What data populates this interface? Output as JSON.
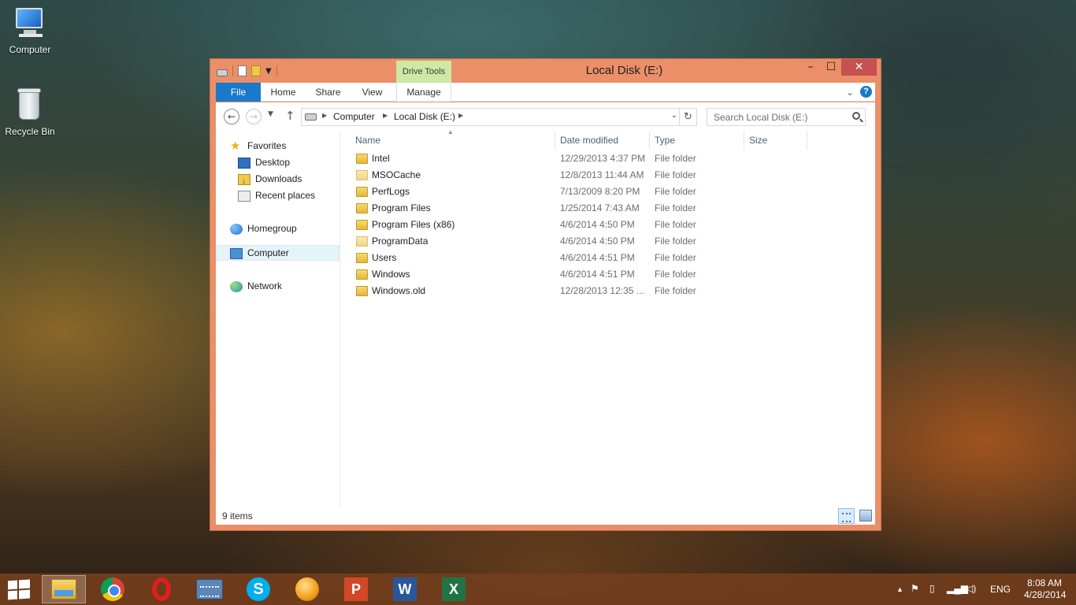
{
  "desktop": {
    "icons": [
      {
        "label": "Computer"
      },
      {
        "label": "Recycle Bin"
      }
    ]
  },
  "window": {
    "title": "Local Disk (E:)",
    "context_tab_group": "Drive Tools",
    "controls": {
      "minimize": "–",
      "maximize": "☐",
      "close": "✕"
    },
    "ribbon_tabs": {
      "file": "File",
      "home": "Home",
      "share": "Share",
      "view": "View",
      "manage": "Manage"
    },
    "help": "?"
  },
  "navigation": {
    "back": "←",
    "forward": "→",
    "up": "↑",
    "breadcrumb": [
      "Computer",
      "Local Disk (E:)"
    ],
    "search_placeholder": "Search Local Disk (E:)"
  },
  "nav_pane": {
    "favorites": "Favorites",
    "favorites_items": [
      "Desktop",
      "Downloads",
      "Recent places"
    ],
    "homegroup": "Homegroup",
    "computer": "Computer",
    "network": "Network",
    "selected": "Computer"
  },
  "file_list": {
    "columns": {
      "name": "Name",
      "date": "Date modified",
      "type": "Type",
      "size": "Size"
    },
    "sort_column": "Name",
    "rows": [
      {
        "name": "Intel",
        "date": "12/29/2013 4:37 PM",
        "type": "File folder"
      },
      {
        "name": "MSOCache",
        "date": "12/8/2013 11:44 AM",
        "type": "File folder"
      },
      {
        "name": "PerfLogs",
        "date": "7/13/2009 8:20 PM",
        "type": "File folder"
      },
      {
        "name": "Program Files",
        "date": "1/25/2014 7:43 AM",
        "type": "File folder"
      },
      {
        "name": "Program Files (x86)",
        "date": "4/6/2014 4:50 PM",
        "type": "File folder"
      },
      {
        "name": "ProgramData",
        "date": "4/6/2014 4:50 PM",
        "type": "File folder"
      },
      {
        "name": "Users",
        "date": "4/6/2014 4:51 PM",
        "type": "File folder"
      },
      {
        "name": "Windows",
        "date": "4/6/2014 4:51 PM",
        "type": "File folder"
      },
      {
        "name": "Windows.old",
        "date": "12/28/2013 12:35 ...",
        "type": "File folder"
      }
    ]
  },
  "status": {
    "item_count": "9 items"
  },
  "taskbar": {
    "apps": [
      "File Explorer",
      "Google Chrome",
      "Opera",
      "On-Screen Keyboard",
      "Skype",
      "Pidgin",
      "PowerPoint",
      "Word",
      "Excel"
    ],
    "app_letters": {
      "skype": "S",
      "ppt": "P",
      "word": "W",
      "excel": "X"
    },
    "tray": {
      "language": "ENG",
      "time": "8:08 AM",
      "date": "4/28/2014"
    }
  },
  "colors": {
    "window_frame": "#ea8f68",
    "file_tab": "#1979ca",
    "drive_tools": "#cde9a4",
    "close_button": "#c75050",
    "taskbar": "#733e1c"
  }
}
